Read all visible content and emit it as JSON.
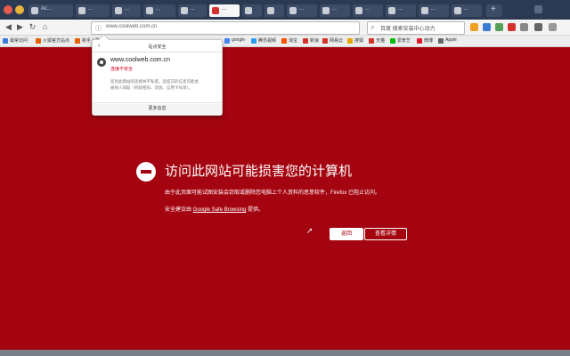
{
  "tabs": [
    {
      "label": "Ac...",
      "active": false
    },
    {
      "label": "...",
      "active": false
    },
    {
      "label": "...",
      "active": false
    },
    {
      "label": "...",
      "active": false
    },
    {
      "label": "...",
      "active": false
    },
    {
      "label": "...",
      "active": false
    },
    {
      "label": "...",
      "active": false
    },
    {
      "label": "...",
      "active": false
    },
    {
      "label": "...",
      "active": false
    },
    {
      "label": "...",
      "active": false
    },
    {
      "label": "...",
      "active": false
    },
    {
      "label": "...",
      "active": false
    },
    {
      "label": "...",
      "active": false
    },
    {
      "label": "...",
      "active": false
    }
  ],
  "toolbar": {
    "url": "www.coolweb.com.cn",
    "search_placeholder": "百度 <Ctrl+K>",
    "search_text": "百度 搜索安装中心动力"
  },
  "bookmarks": [
    {
      "label": "最常访问",
      "color": "#3b7bd8"
    },
    {
      "label": "火狐官方站点",
      "color": "#e66000"
    },
    {
      "label": "新手上路",
      "color": "#e66000"
    },
    {
      "label": "常用网址",
      "color": "#3b7bd8"
    },
    {
      "label": "京东商城",
      "color": "#d4322c"
    },
    {
      "label": "百度一下",
      "color": "#3b7bd8"
    },
    {
      "label": "google",
      "color": "#4285f4"
    },
    {
      "label": "腾讯视频",
      "color": "#2c9cf2"
    },
    {
      "label": "淘宝",
      "color": "#ff5000"
    },
    {
      "label": "新浪",
      "color": "#d4322c"
    },
    {
      "label": "网易云",
      "color": "#d4322c"
    },
    {
      "label": "搜狐",
      "color": "#e6a400"
    },
    {
      "label": "天猫",
      "color": "#d4322c"
    },
    {
      "label": "爱奇艺",
      "color": "#00be06"
    },
    {
      "label": "微博",
      "color": "#e6162d"
    },
    {
      "label": "Apple",
      "color": "#666666"
    }
  ],
  "popup": {
    "title": "站点安全",
    "domain": "www.coolweb.com.cn",
    "status": "连接不安全",
    "detail_line1": "您到此网站的连接并不私密。您提交的信息可能会",
    "detail_line2": "被他人窃取（例如密码、消息、信用卡号等）。",
    "more_button": "更多信息"
  },
  "warning": {
    "title": "访问此网站可能损害您的计算机",
    "description": "由于此页面可能试图安装会窃取或删除您电脑上个人资料的恶意软件，Firefox 已阻止访问。",
    "advice_prefix": "安全建议由 ",
    "advice_link": "Google Safe Browsing",
    "advice_suffix": " 提供。",
    "back_button": "返回",
    "details_button": "查看详情"
  },
  "colors": {
    "warning_background": "#a4040f",
    "tab_strip": "#2b3a52"
  }
}
